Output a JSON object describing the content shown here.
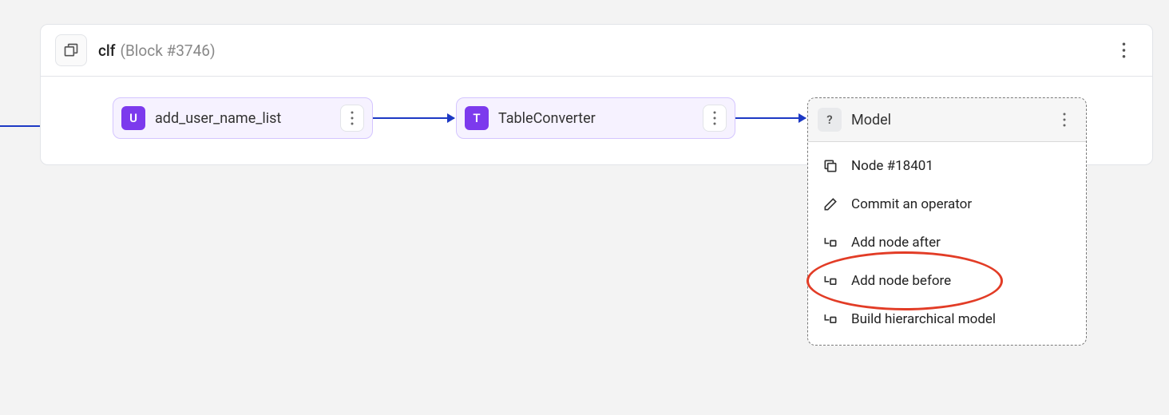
{
  "header": {
    "title": "clf",
    "subtitle": "(Block #3746)"
  },
  "nodes": [
    {
      "badge": "U",
      "label": "add_user_name_list"
    },
    {
      "badge": "T",
      "label": "TableConverter"
    }
  ],
  "dropdown": {
    "badge": "?",
    "label": "Model",
    "menu": [
      {
        "label": "Node #18401"
      },
      {
        "label": "Commit an operator"
      },
      {
        "label": "Add node after"
      },
      {
        "label": "Add node before"
      },
      {
        "label": "Build hierarchical model"
      }
    ]
  }
}
